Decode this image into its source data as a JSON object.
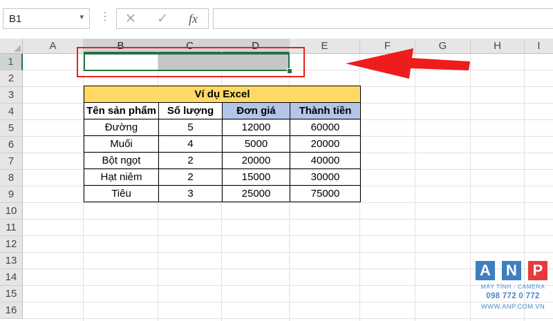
{
  "formula_bar": {
    "name_box": "B1",
    "name_box_arrow": "▾",
    "dots": "⋮",
    "cancel_icon": "✕",
    "enter_icon": "✓",
    "fx_label": "fx",
    "formula": ""
  },
  "columns": [
    "A",
    "B",
    "C",
    "D",
    "E",
    "F",
    "G",
    "H",
    "I"
  ],
  "rows": [
    "1",
    "2",
    "3",
    "4",
    "5",
    "6",
    "7",
    "8",
    "9",
    "10",
    "11",
    "12",
    "13",
    "14",
    "15",
    "16"
  ],
  "table": {
    "title": "Ví dụ Excel",
    "headers": [
      "Tên sản phẩm",
      "Số lượng",
      "Đơn giá",
      "Thành tiền"
    ],
    "rows": [
      [
        "Đường",
        "5",
        "12000",
        "60000"
      ],
      [
        "Muối",
        "4",
        "5000",
        "20000"
      ],
      [
        "Bột ngọt",
        "2",
        "20000",
        "40000"
      ],
      [
        "Hạt niêm",
        "2",
        "15000",
        "30000"
      ],
      [
        "Tiêu",
        "3",
        "25000",
        "75000"
      ]
    ]
  },
  "logo": {
    "letters": [
      "A",
      "N",
      "P"
    ],
    "tagline": "MÁY TÍNH - CAMERA",
    "phone": "098 772 0 772",
    "url": "WWW.ANP.COM.VN"
  },
  "colors": {
    "excel_green": "#217346",
    "callout_red": "#ee1c1c",
    "title_fill": "#ffd966",
    "header_fill": "#b4c6e7",
    "logo_blue": "#3d7fc1",
    "logo_red": "#e63b3b"
  }
}
